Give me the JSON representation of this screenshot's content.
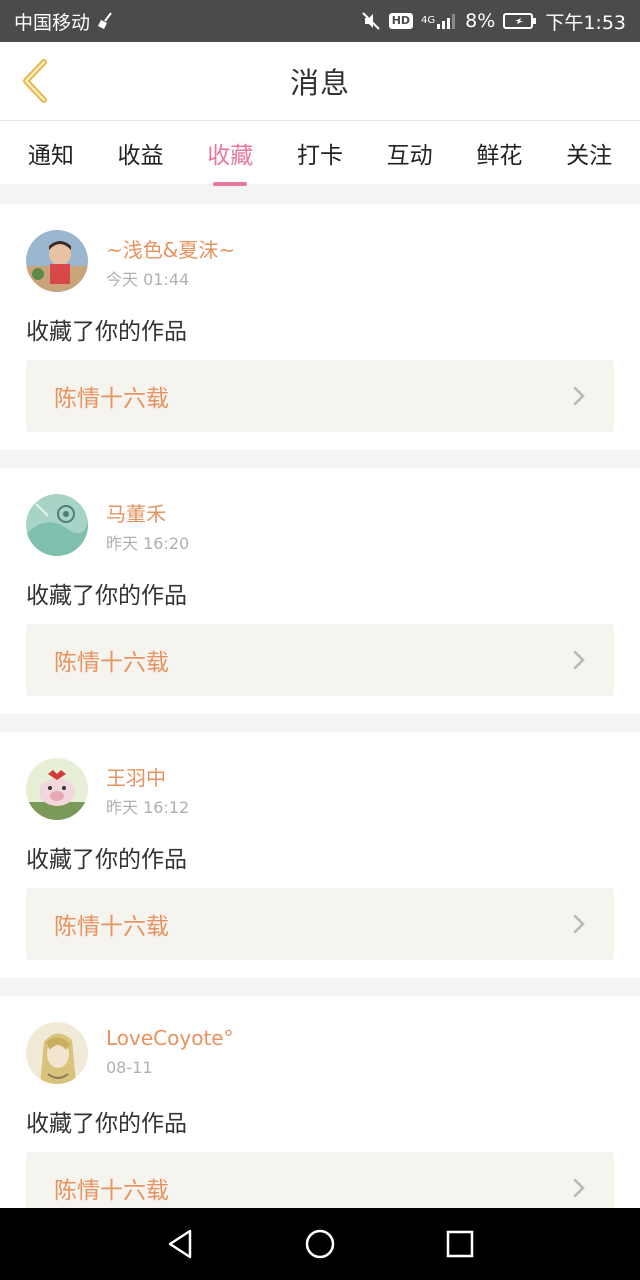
{
  "status_bar": {
    "carrier": "中国移动",
    "hd": "HD",
    "network": "4G",
    "battery_percent": "8%",
    "time": "下午1:53"
  },
  "header": {
    "title": "消息"
  },
  "tabs": [
    {
      "label": "通知"
    },
    {
      "label": "收益"
    },
    {
      "label": "收藏",
      "active": true
    },
    {
      "label": "打卡"
    },
    {
      "label": "互动"
    },
    {
      "label": "鲜花"
    },
    {
      "label": "关注"
    }
  ],
  "messages": [
    {
      "username": "~浅色&夏沫~",
      "time": "今天 01:44",
      "action": "收藏了你的作品",
      "work_title": "陈情十六载"
    },
    {
      "username": "马董禾",
      "time": "昨天 16:20",
      "action": "收藏了你的作品",
      "work_title": "陈情十六载"
    },
    {
      "username": "王羽中",
      "time": "昨天 16:12",
      "action": "收藏了你的作品",
      "work_title": "陈情十六载"
    },
    {
      "username": "LoveCoyote°",
      "time": "08-11",
      "action": "收藏了你的作品",
      "work_title": "陈情十六载"
    }
  ],
  "colors": {
    "accent_pink": "#e8789e",
    "accent_orange": "#e8935f",
    "back_arrow": "#e6b84a"
  }
}
